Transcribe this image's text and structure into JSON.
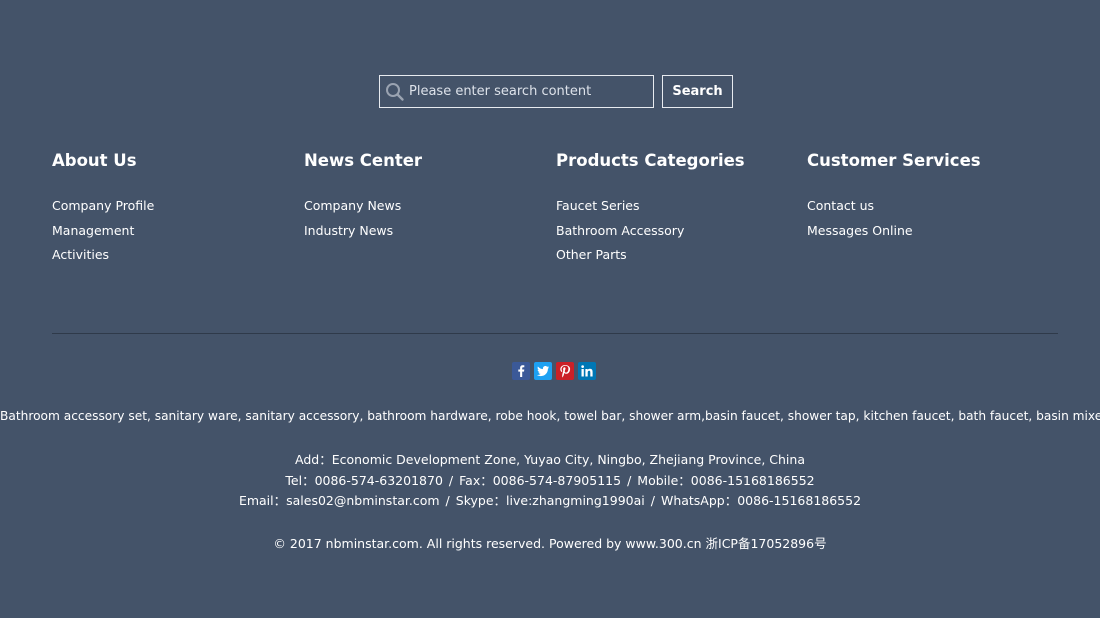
{
  "search": {
    "placeholder": "Please enter search content",
    "button_label": "Search"
  },
  "columns": [
    {
      "title": "About Us",
      "items": [
        "Company Profile",
        "Management",
        "Activities"
      ]
    },
    {
      "title": "News Center",
      "items": [
        "Company News",
        "Industry News"
      ]
    },
    {
      "title": "Products Categories",
      "items": [
        "Faucet Series",
        "Bathroom Accessory",
        "Other Parts"
      ]
    },
    {
      "title": "Customer Services",
      "items": [
        "Contact us",
        "Messages Online"
      ]
    }
  ],
  "social": [
    {
      "name": "facebook-icon",
      "glyph": "f",
      "color": "#3b5998"
    },
    {
      "name": "twitter-icon",
      "glyph": "t",
      "color": "#1da1f2"
    },
    {
      "name": "pinterest-icon",
      "glyph": "p",
      "color": "#cb2027"
    },
    {
      "name": "linkedin-icon",
      "glyph": "in",
      "color": "#0077b5"
    }
  ],
  "footer": {
    "keywords": "Bathroom accessory set, sanitary ware, sanitary accessory, bathroom hardware, robe hook, towel bar, shower arm,basin faucet, shower tap, kitchen faucet, bath faucet, basin mixer",
    "add_label": "Add：",
    "add_value": "Economic Development Zone, Yuyao City, Ningbo, Zhejiang Province, China",
    "tel_label": "Tel：",
    "tel_value": "0086-574-63201870",
    "fax_label": "Fax：",
    "fax_value": "0086-574-87905115",
    "mobile_label": "Mobile：",
    "mobile_value": "0086-15168186552",
    "email_label": "Email：",
    "email_value": "sales02@nbminstar.com",
    "skype_label": "Skype：",
    "skype_value": "live:zhangming1990ai",
    "whatsapp_label": "WhatsApp：",
    "whatsapp_value": "0086-15168186552",
    "separator": "/",
    "copyright": "© 2017 nbminstar.com. All rights reserved. Powered by www.300.cn 浙ICP备17052896号"
  },
  "colors": {
    "background": "#445369",
    "divider": "#2f3a4a",
    "text": "#ffffff"
  }
}
